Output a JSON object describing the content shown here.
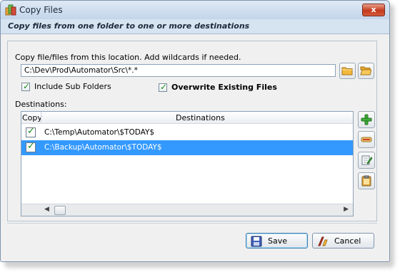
{
  "window": {
    "title": "Copy Files",
    "close_label": "x",
    "subtitle": "Copy files from one folder to one or more destinations"
  },
  "source": {
    "label": "Copy file/files from this location.  Add wildcards if needed.",
    "path_value": "C:\\Dev\\Prod\\Automator\\Src\\*.*",
    "browse_folder_icon": "folder-icon",
    "browse_folder2_icon": "folder-open-icon"
  },
  "options": {
    "include_sub_folders_label": "Include Sub Folders",
    "include_sub_folders_checked": true,
    "overwrite_label": "Overwrite Existing Files",
    "overwrite_checked": true
  },
  "destinations": {
    "label": "Destinations:",
    "columns": [
      "Copy",
      "Destinations"
    ],
    "rows": [
      {
        "copy": true,
        "path": "C:\\Temp\\Automator\\$TODAY$",
        "selected": false
      },
      {
        "copy": true,
        "path": "C:\\Backup\\Automator\\$TODAY$",
        "selected": true
      }
    ],
    "side_buttons": [
      "add-icon",
      "remove-icon",
      "edit-icon",
      "paste-icon"
    ]
  },
  "footer": {
    "save_label": "Save",
    "cancel_label": "Cancel"
  },
  "colors": {
    "selection": "#3399ff",
    "check_green": "#1a8f1a",
    "close_red": "#c43a1c"
  }
}
